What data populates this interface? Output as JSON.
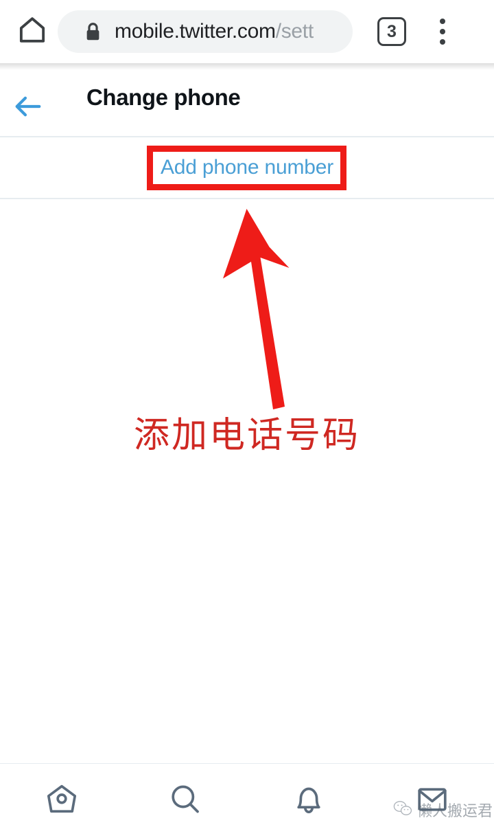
{
  "browser": {
    "home_icon": "home-icon",
    "lock_icon": "lock-icon",
    "url_domain": "mobile.twitter.com",
    "url_path": "/sett",
    "tab_count": "3",
    "overflow_icon": "three-dot-menu-icon"
  },
  "header": {
    "back_icon": "back-arrow-icon",
    "title": "Change phone"
  },
  "content": {
    "add_phone_label": "Add phone number"
  },
  "annotations": {
    "highlight_color": "#ee1c18",
    "arrow_color": "#ee1c18",
    "caption": "添加电话号码",
    "caption_color": "#cf2822"
  },
  "bottom_nav": {
    "items": [
      {
        "name": "home",
        "icon": "home-birdhouse-icon"
      },
      {
        "name": "search",
        "icon": "search-icon"
      },
      {
        "name": "notifications",
        "icon": "bell-icon"
      },
      {
        "name": "messages",
        "icon": "envelope-icon"
      }
    ]
  },
  "watermark": {
    "icon": "wechat-icon",
    "text": "懒人搬运君"
  },
  "colors": {
    "twitter_blue": "#4a9fd5",
    "nav_icon": "#5b6b7c",
    "title": "#0f1419",
    "divider": "#e6ecf0"
  }
}
